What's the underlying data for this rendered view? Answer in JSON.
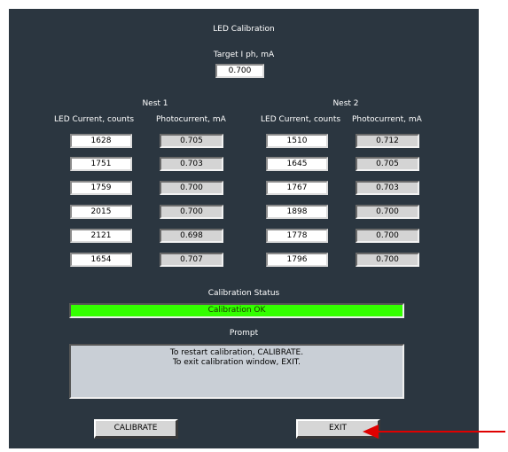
{
  "window": {
    "title": "LED Calibration"
  },
  "target": {
    "label": "Target I ph, mA",
    "value": "0.700"
  },
  "nest1": {
    "title": "Nest 1",
    "led_header": "LED Current, counts",
    "photo_header": "Photocurrent, mA",
    "rows": [
      {
        "led": "1628",
        "photo": "0.705"
      },
      {
        "led": "1751",
        "photo": "0.703"
      },
      {
        "led": "1759",
        "photo": "0.700"
      },
      {
        "led": "2015",
        "photo": "0.700"
      },
      {
        "led": "2121",
        "photo": "0.698"
      },
      {
        "led": "1654",
        "photo": "0.707"
      }
    ]
  },
  "nest2": {
    "title": "Nest 2",
    "led_header": "LED Current, counts",
    "photo_header": "Photocurrent, mA",
    "rows": [
      {
        "led": "1510",
        "photo": "0.712"
      },
      {
        "led": "1645",
        "photo": "0.705"
      },
      {
        "led": "1767",
        "photo": "0.703"
      },
      {
        "led": "1898",
        "photo": "0.700"
      },
      {
        "led": "1778",
        "photo": "0.700"
      },
      {
        "led": "1796",
        "photo": "0.700"
      }
    ]
  },
  "status": {
    "label": "Calibration Status",
    "value": "Calibration OK",
    "color": "#33ff00"
  },
  "prompt": {
    "label": "Prompt",
    "lines": [
      "To restart calibration, CALIBRATE.",
      "To exit calibration window, EXIT."
    ]
  },
  "buttons": {
    "calibrate": "CALIBRATE",
    "exit": "EXIT"
  },
  "colors": {
    "panel": "#2b3640",
    "arrow": "#e00000"
  }
}
